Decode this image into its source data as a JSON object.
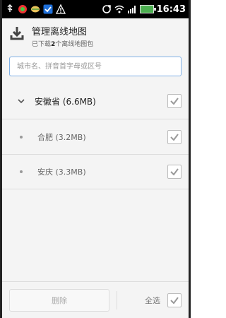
{
  "statusbar": {
    "time": "16:43"
  },
  "header": {
    "title": "管理离线地图",
    "subtitle_prefix": "已下载",
    "subtitle_count": "2",
    "subtitle_suffix": "个离线地图包"
  },
  "search": {
    "placeholder": "城市名、拼音首字母或区号"
  },
  "list": {
    "province": {
      "name": "安徽省 (6.6MB)",
      "checked": true
    },
    "cities": [
      {
        "name": "合肥 (3.2MB)",
        "checked": true
      },
      {
        "name": "安庆 (3.3MB)",
        "checked": true
      }
    ]
  },
  "footer": {
    "delete_label": "删除",
    "select_all_label": "全选",
    "select_all_checked": true
  }
}
